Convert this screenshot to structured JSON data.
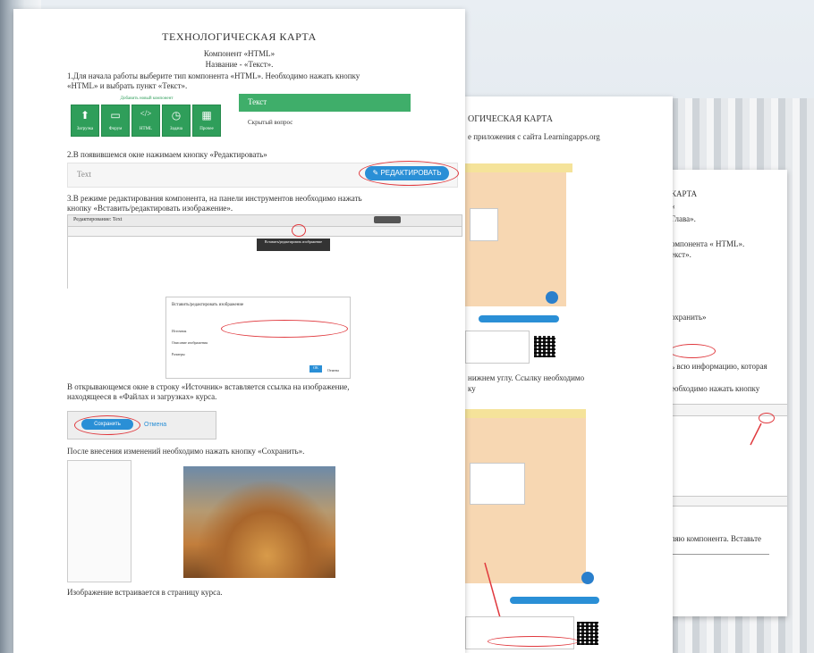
{
  "page3": {
    "line1": "КАРТА",
    "line2": "«",
    "line3": "Глава».",
    "line4": "омпонента « HTML».",
    "line5": "екст».",
    "line6": "охранить»",
    "line7": "ь всю информацию, которая",
    "line8": "еобходимо нажать кнопку",
    "line9": "ляю компонента. Вставьте"
  },
  "page2": {
    "title": "ОГИЧЕСКАЯ КАРТА",
    "line1": "е приложения с сайта Learningapps.org",
    "line2": "нижнем углу. Ссылку необходимо",
    "line3": "ку"
  },
  "page1": {
    "title": "ТЕХНОЛОГИЧЕСКАЯ КАРТА",
    "component": "Компонент «HTML»",
    "name": "Название - «Текст».",
    "step1": "1.Для начала работы выберите тип компонента «HTML». Необходимо нажать кнопку",
    "step1b": "«HTML» и выбрать пункт «Текст».",
    "add_block": "Добавить новый компонент",
    "icons": [
      {
        "icon": "upload-icon",
        "label": "Загрузка"
      },
      {
        "icon": "chat-icon",
        "label": "Форум"
      },
      {
        "icon": "code-icon",
        "label": "HTML"
      },
      {
        "icon": "clock-icon",
        "label": "Задача"
      },
      {
        "icon": "grid-icon",
        "label": "Прочее"
      }
    ],
    "menu_text": "Текст",
    "menu_hidden": "Скрытый вопрос",
    "step2": "2.В появившемся окне нажимаем кнопку «Редактировать»",
    "text_label": "Text",
    "edit_button": "РЕДАКТИРОВАТЬ",
    "step3": "3.В режиме редактирования компонента, на панели инструментов необходимо нажать",
    "step3b": "кнопку «Вставить/редактировать изображение».",
    "editor_label": "Редактирование: Text",
    "tooltip": "Вставить/редактировать изображение",
    "dialog_title": "Вставить/редактировать изображение",
    "dialog_source": "Источник",
    "dialog_desc": "Описание изображения",
    "dialog_size": "Размеры",
    "dialog_ok": "OK",
    "dialog_cancel": "Отмена",
    "para1": "В открывающемся окне в строку «Источник» вставляется ссылка на изображение,",
    "para1b": "находящееся в «Файлах и загрузках» курса.",
    "save_button": "Сохранить",
    "cancel_link": "Отмена",
    "para2": "После внесения изменений необходимо нажать кнопку «Сохранить».",
    "para3": "Изображение встраивается в страницу курса."
  }
}
